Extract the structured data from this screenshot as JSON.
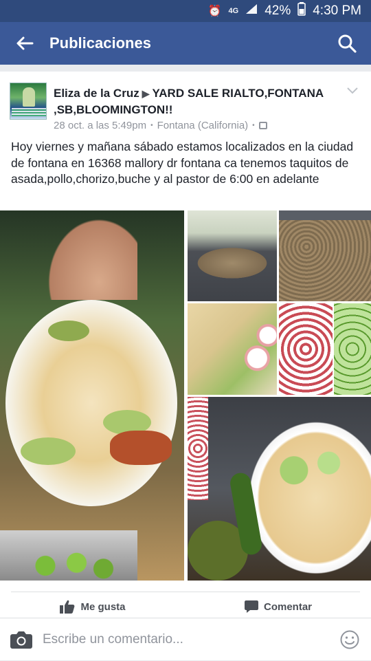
{
  "status_bar": {
    "alarm_icon": "alarm-icon",
    "network_label": "4G",
    "signal_icon": "signal-icon",
    "battery": "42%",
    "battery_icon": "battery-icon",
    "time": "4:30 PM"
  },
  "app_bar": {
    "title": "Publicaciones",
    "back_icon": "back-arrow-icon",
    "search_icon": "search-icon"
  },
  "post": {
    "author": "Eliza de la Cruz",
    "group": "YARD SALE RIALTO,FONTANA ,SB,BLOOMINGTON!!",
    "timestamp": "28 oct. a las 5:49pm",
    "location": "Fontana (California)",
    "text": "Hoy viernes y mañana sábado estamos localizados en la ciudad de fontana en 16368 mallory dr fontana ca tenemos taquitos de asada,pollo,chorizo,buche y al pastor de 6:00 en adelante",
    "photo_count": 7
  },
  "actions": {
    "like_label": "Me gusta",
    "comment_label": "Comentar"
  },
  "comment_bar": {
    "placeholder": "Escribe un comentario..."
  },
  "colors": {
    "brand": "#3b5998",
    "status_bar": "#2f4a7c",
    "text": "#1d2129",
    "meta": "#90949c"
  }
}
